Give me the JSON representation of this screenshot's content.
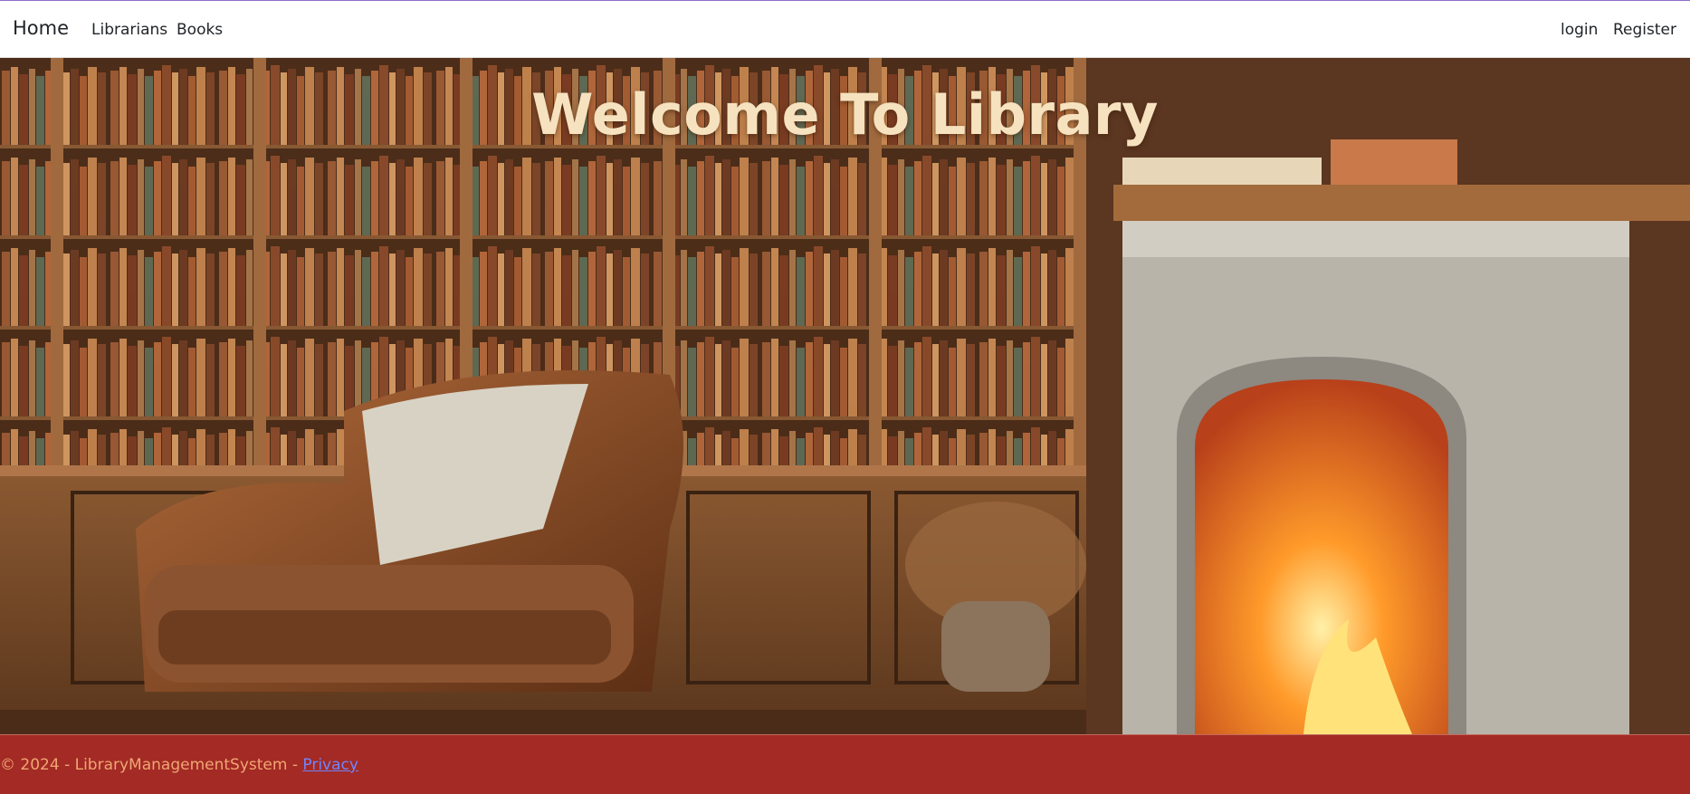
{
  "nav": {
    "brand": "Home",
    "links": {
      "librarians": "Librarians",
      "books": "Books"
    },
    "auth": {
      "login": "login",
      "register": "Register"
    }
  },
  "hero": {
    "title": "Welcome To Library"
  },
  "footer": {
    "copyright": "© 2024 - LibraryManagementSystem - ",
    "privacy_link": "Privacy"
  },
  "colors": {
    "footer_bg": "#a32a25",
    "footer_text": "#f0a672",
    "footer_link": "#7085ff",
    "title_color": "#f6e2bf",
    "top_accent": "#8e6fc9"
  }
}
